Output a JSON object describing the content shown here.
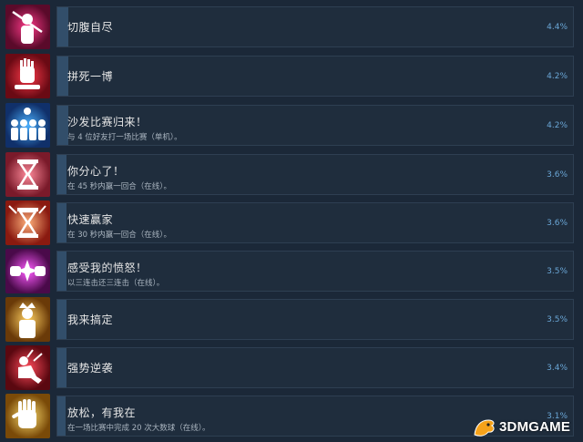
{
  "achievements": [
    {
      "title": "切腹自尽",
      "description": "",
      "percent": "4.4%",
      "progress": 0.044,
      "icon": "stabbed-figure-icon",
      "colors": [
        "#e0126a",
        "#5a0a2a"
      ]
    },
    {
      "title": "拼死一博",
      "description": "",
      "percent": "4.2%",
      "progress": 0.042,
      "icon": "raised-hand-icon",
      "colors": [
        "#e0203a",
        "#6a0a14"
      ]
    },
    {
      "title": "沙发比赛归来！",
      "description": "与 4 位好友打一场比赛（单机）。",
      "percent": "4.2%",
      "progress": 0.042,
      "icon": "four-players-icon",
      "colors": [
        "#2a8ad8",
        "#10306a"
      ]
    },
    {
      "title": "你分心了！",
      "description": "在 45 秒内赢一回合（在线）。",
      "percent": "3.6%",
      "progress": 0.036,
      "icon": "hourglass-icon",
      "colors": [
        "#e85a6a",
        "#7a1a2a"
      ]
    },
    {
      "title": "快速赢家",
      "description": "在 30 秒内赢一回合（在线）。",
      "percent": "3.6%",
      "progress": 0.036,
      "icon": "hourglass-burst-icon",
      "colors": [
        "#f06a3a",
        "#8a1a10"
      ]
    },
    {
      "title": "感受我的愤怒！",
      "description": "以三连击还三连击（在线）。",
      "percent": "3.5%",
      "progress": 0.035,
      "icon": "fist-clash-icon",
      "colors": [
        "#c020c0",
        "#4a0a4a"
      ]
    },
    {
      "title": "我来搞定",
      "description": "",
      "percent": "3.5%",
      "progress": 0.035,
      "icon": "crowned-figure-icon",
      "colors": [
        "#f0a020",
        "#6a3a08"
      ]
    },
    {
      "title": "强势逆袭",
      "description": "",
      "percent": "3.4%",
      "progress": 0.034,
      "icon": "kneeling-figure-icon",
      "colors": [
        "#e01a2a",
        "#5a0810"
      ]
    },
    {
      "title": "放松，有我在",
      "description": "在一场比赛中完成 20 次大数球（在线）。",
      "percent": "3.1%",
      "progress": 0.031,
      "icon": "open-hand-icon",
      "colors": [
        "#f0b020",
        "#7a4a08"
      ]
    }
  ],
  "watermark": {
    "text": "3DMGAME"
  }
}
